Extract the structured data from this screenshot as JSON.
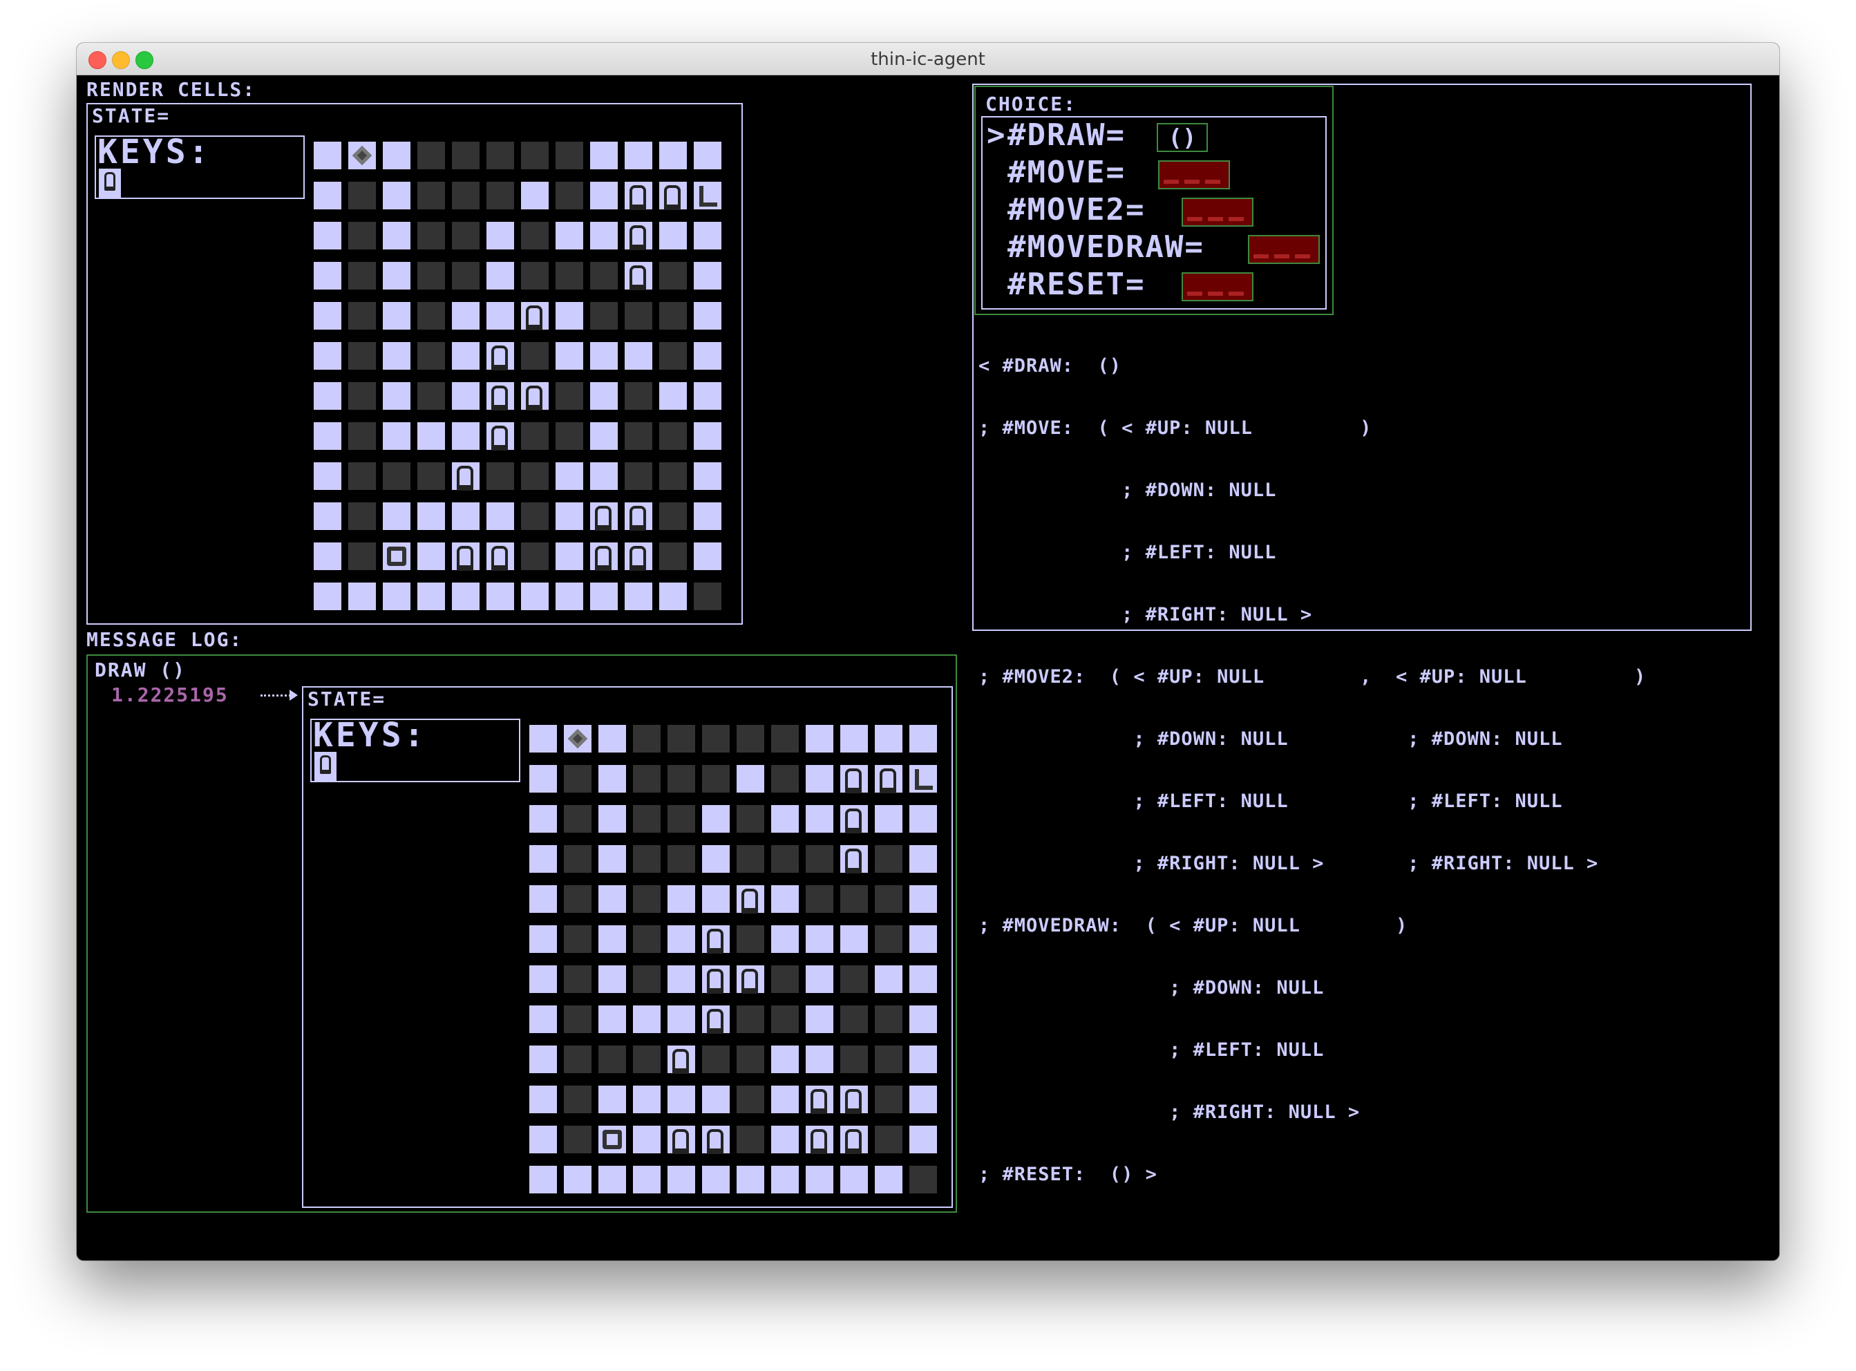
{
  "window": {
    "title": "thin-ic-agent"
  },
  "render_cells": {
    "label": "RENDER CELLS:",
    "state_label": "STATE=",
    "keys_label": "KEYS:",
    "board_rows": [
      "WCWDDDDDWWWW",
      "WDWDDDWDWKKL",
      "WDWDDWDWWKWW",
      "WDWDDWDDDKDW",
      "WDWDWWKWDDDW",
      "WDWDWKDWWWDW",
      "WDWDWKKDWDWW",
      "WDWWWKDDWDDW",
      "WDDDKDDWWDDW",
      "WDWWWWDWKKDW",
      "WDRWKKDWKKDW",
      "WWWWWWWWWWWD"
    ]
  },
  "choice": {
    "label": "CHOICE:",
    "items": [
      {
        "name": "#DRAW=",
        "arg": "()",
        "selected": true
      },
      {
        "name": "#MOVE=",
        "arg": null,
        "selected": false
      },
      {
        "name": "#MOVE2=",
        "arg": null,
        "selected": false
      },
      {
        "name": "#MOVEDRAW=",
        "arg": null,
        "selected": false
      },
      {
        "name": "#RESET=",
        "arg": null,
        "selected": false
      }
    ],
    "cursor": ">"
  },
  "type_schema": {
    "lines": [
      "< #DRAW:  ()",
      "; #MOVE:  ( < #UP: NULL         )",
      "            ; #DOWN: NULL",
      "            ; #LEFT: NULL",
      "            ; #RIGHT: NULL >",
      "; #MOVE2:  ( < #UP: NULL        ,  < #UP: NULL         )",
      "             ; #DOWN: NULL          ; #DOWN: NULL",
      "             ; #LEFT: NULL          ; #LEFT: NULL",
      "             ; #RIGHT: NULL >       ; #RIGHT: NULL >",
      "; #MOVEDRAW:  ( < #UP: NULL        )",
      "                ; #DOWN: NULL",
      "                ; #LEFT: NULL",
      "                ; #RIGHT: NULL >",
      "; #RESET:  () >"
    ]
  },
  "message_log": {
    "label": "MESSAGE LOG:",
    "entry": {
      "action": "DRAW ()",
      "timestamp": "1.2225195",
      "state_label": "STATE=",
      "keys_label": "KEYS:"
    }
  }
}
